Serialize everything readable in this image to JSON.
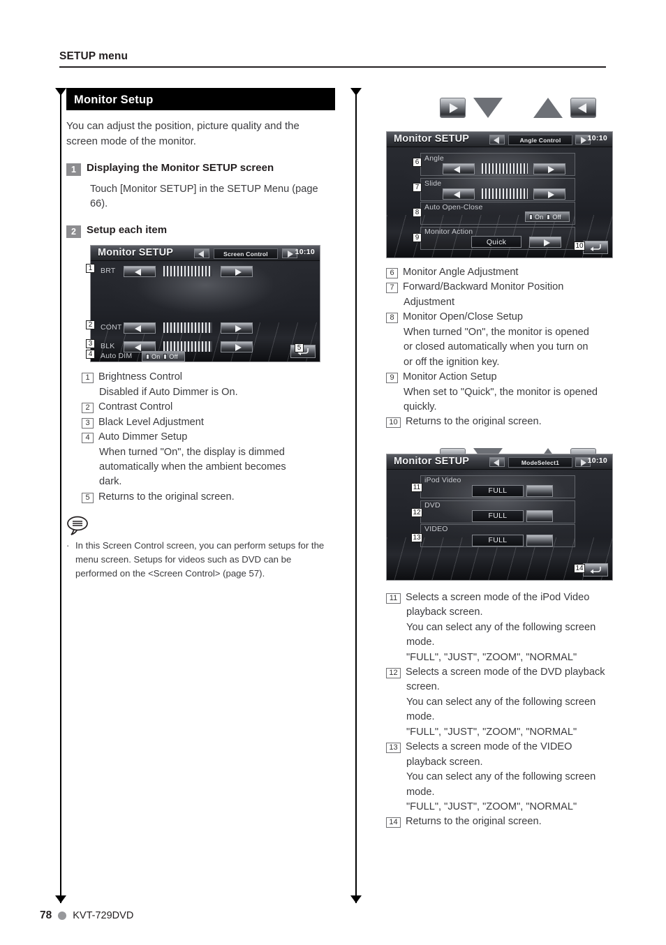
{
  "header": {
    "title": "SETUP menu"
  },
  "section": {
    "title": "Monitor Setup",
    "intro": "You can adjust the position, picture quality and the screen mode of the monitor."
  },
  "steps": [
    {
      "num": "1",
      "title": "Displaying the Monitor SETUP screen",
      "body": "Touch [Monitor SETUP] in the SETUP Menu (page 66)."
    },
    {
      "num": "2",
      "title": "Setup each item",
      "body": ""
    }
  ],
  "screens": {
    "screen_control": {
      "title": "Monitor SETUP",
      "mode": "Screen Control",
      "clock": "10:10",
      "rows": [
        {
          "callout": "1",
          "label": "BRT"
        },
        {
          "callout": "2",
          "label": "CONT"
        },
        {
          "callout": "3",
          "label": "BLK"
        }
      ],
      "dimmer": {
        "callout": "4",
        "label": "Auto DIM",
        "on": "On",
        "off": "Off"
      },
      "return_callout": "5"
    },
    "angle_control": {
      "title": "Monitor SETUP",
      "mode": "Angle Control",
      "clock": "10:10",
      "groups": [
        {
          "callout": "6",
          "label": "Angle",
          "type": "gauge"
        },
        {
          "callout": "7",
          "label": "Slide",
          "type": "gauge"
        },
        {
          "callout": "8",
          "label": "Auto Open-Close",
          "type": "toggle",
          "on": "On",
          "off": "Off"
        },
        {
          "callout": "9",
          "label": "Monitor Action",
          "type": "value",
          "value": "Quick"
        }
      ],
      "return_callout": "10"
    },
    "mode_select": {
      "title": "Monitor SETUP",
      "mode": "ModeSelect1",
      "clock": "10:10",
      "groups": [
        {
          "callout": "11",
          "label": "iPod Video",
          "value": "FULL"
        },
        {
          "callout": "12",
          "label": "DVD",
          "value": "FULL"
        },
        {
          "callout": "13",
          "label": "VIDEO",
          "value": "FULL"
        }
      ],
      "return_callout": "14"
    }
  },
  "left_items": [
    {
      "num": "1",
      "text": "Brightness Control",
      "sub": [
        "Disabled if Auto Dimmer is On."
      ]
    },
    {
      "num": "2",
      "text": "Contrast Control",
      "sub": []
    },
    {
      "num": "3",
      "text": "Black Level Adjustment",
      "sub": []
    },
    {
      "num": "4",
      "text": "Auto Dimmer Setup",
      "sub": [
        "When turned \"On\", the display is dimmed",
        "automatically when the ambient becomes",
        "dark."
      ]
    },
    {
      "num": "5",
      "text": "Returns to the original screen.",
      "sub": []
    }
  ],
  "note": {
    "bullet": "·",
    "text": "In this Screen Control screen, you can perform setups for the menu screen. Setups for videos such as DVD can be performed on the <Screen Control> (page 57)."
  },
  "right_items_a": [
    {
      "num": "6",
      "text": "Monitor Angle Adjustment",
      "sub": []
    },
    {
      "num": "7",
      "text": "Forward/Backward Monitor Position",
      "sub": [
        "Adjustment"
      ]
    },
    {
      "num": "8",
      "text": "Monitor Open/Close Setup",
      "sub": [
        "When turned \"On\", the monitor is opened",
        "or closed automatically when you turn on",
        "or off the ignition key."
      ]
    },
    {
      "num": "9",
      "text": "Monitor Action Setup",
      "sub": [
        "When set to \"Quick\", the monitor is opened",
        "quickly."
      ]
    },
    {
      "num": "10",
      "text": "Returns to the original screen.",
      "sub": []
    }
  ],
  "right_items_b": [
    {
      "num": "11",
      "text": "Selects a screen mode of the iPod Video",
      "sub": [
        "playback screen.",
        "You can select any of the following screen",
        "mode.",
        "\"FULL\", \"JUST\", \"ZOOM\", \"NORMAL\""
      ]
    },
    {
      "num": "12",
      "text": "Selects a screen mode of the DVD playback",
      "sub": [
        "screen.",
        "You can select any of the following screen",
        "mode.",
        "\"FULL\", \"JUST\", \"ZOOM\", \"NORMAL\""
      ]
    },
    {
      "num": "13",
      "text": "Selects a screen mode of the VIDEO",
      "sub": [
        "playback screen.",
        "You can select any of the following screen",
        "mode.",
        "\"FULL\", \"JUST\", \"ZOOM\", \"NORMAL\""
      ]
    },
    {
      "num": "14",
      "text": "Returns to the original screen.",
      "sub": []
    }
  ],
  "nav_icons": [
    "play-right-button",
    "triangle-down",
    "triangle-up",
    "play-left-button"
  ],
  "footer": {
    "page": "78",
    "model": "KVT-729DVD"
  },
  "colors": {
    "bar_bg": "#000000",
    "step_num_bg": "#8d8d90",
    "text": "#3b3b3e",
    "dot": "#97989b"
  }
}
